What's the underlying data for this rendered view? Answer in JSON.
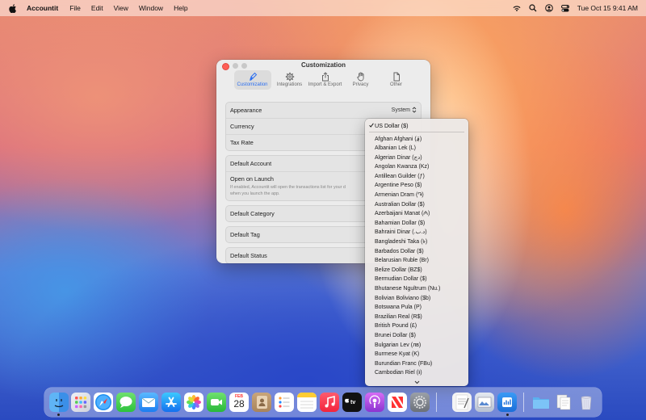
{
  "menubar": {
    "apple_icon": "apple-logo-icon",
    "app_name": "Accountit",
    "items": [
      "File",
      "Edit",
      "View",
      "Window",
      "Help"
    ],
    "clock": "Tue Oct 15  9:41 AM"
  },
  "window": {
    "title": "Customization",
    "toolbar": [
      {
        "label": "Customization",
        "icon": "paintbrush-icon",
        "active": true
      },
      {
        "label": "Integrations",
        "icon": "gear-icon",
        "active": false
      },
      {
        "label": "Import & Export",
        "icon": "share-icon",
        "active": false
      },
      {
        "label": "Privacy",
        "icon": "hand-icon",
        "active": false
      },
      {
        "label": "Other",
        "icon": "document-icon",
        "active": false
      }
    ],
    "settings": {
      "appearance_label": "Appearance",
      "appearance_value": "System",
      "currency_label": "Currency",
      "tax_rate_label": "Tax Rate",
      "default_account_label": "Default Account",
      "open_on_launch_label": "Open on Launch",
      "open_on_launch_desc": "If enabled, Accountit will open the transactions list for your d",
      "open_on_launch_desc2": "when you launch the app.",
      "default_category_label": "Default Category",
      "default_tag_label": "Default Tag",
      "default_status_label": "Default Status"
    }
  },
  "currency_menu": {
    "selected": "US Dollar ($)",
    "items": [
      "Afghan Afghani (؋)",
      "Albanian Lek (L)",
      "Algerian Dinar (دج)",
      "Angolan Kwanza (Kz)",
      "Antillean Guilder (ƒ)",
      "Argentine Peso ($)",
      "Armenian Dram (֏)",
      "Australian Dollar ($)",
      "Azerbaijani Manat (₼)",
      "Bahamian Dollar ($)",
      "Bahraini Dinar (.د.ب)",
      "Bangladeshi Taka (৳)",
      "Barbados Dollar ($)",
      "Belarusian Ruble (Br)",
      "Belize Dollar (BZ$)",
      "Bermudian Dollar ($)",
      "Bhutanese Ngultrum (Nu.)",
      "Bolivian Boliviano ($b)",
      "Botswana Pula (P)",
      "Brazilian Real (R$)",
      "British Pound (£)",
      "Brunei Dollar ($)",
      "Bulgarian Lev (лв)",
      "Burmese Kyat (K)",
      "Burundian Franc (FBu)",
      "Cambodian Riel (៛)"
    ]
  },
  "dock": {
    "calendar_month": "FEB",
    "calendar_day": "28"
  }
}
